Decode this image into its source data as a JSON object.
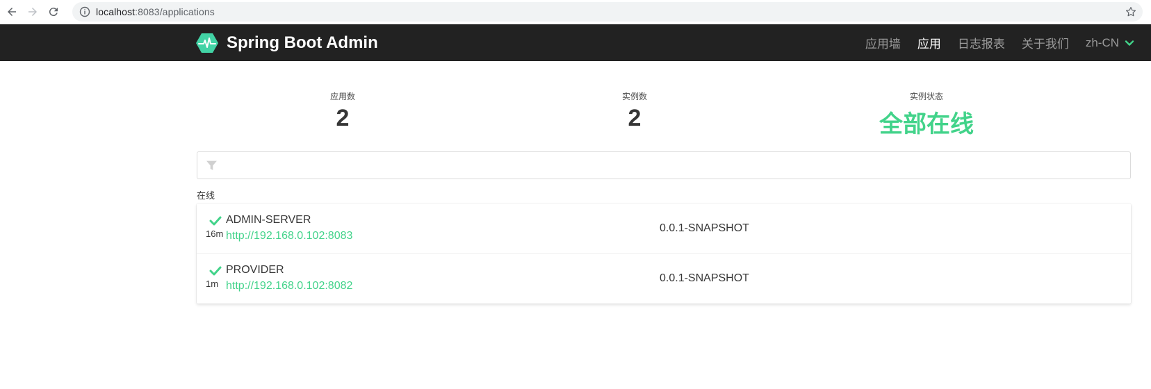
{
  "browser": {
    "url_host": "localhost",
    "url_rest": ":8083/applications"
  },
  "navbar": {
    "brand": "Spring Boot Admin",
    "items": [
      {
        "label": "应用墙",
        "active": false
      },
      {
        "label": "应用",
        "active": true
      },
      {
        "label": "日志报表",
        "active": false
      },
      {
        "label": "关于我们",
        "active": false
      }
    ],
    "language": "zh-CN"
  },
  "stats": {
    "apps_label": "应用数",
    "apps_value": "2",
    "instances_label": "实例数",
    "instances_value": "2",
    "status_label": "实例状态",
    "status_value": "全部在线"
  },
  "filter": {
    "placeholder": "",
    "value": ""
  },
  "group": {
    "label": "在线"
  },
  "applications": [
    {
      "name": "ADMIN-SERVER",
      "uptime": "16m",
      "url": "http://192.168.0.102:8083",
      "version": "0.0.1-SNAPSHOT"
    },
    {
      "name": "PROVIDER",
      "uptime": "1m",
      "url": "http://192.168.0.102:8082",
      "version": "0.0.1-SNAPSHOT"
    }
  ],
  "colors": {
    "navbar_bg": "#222222",
    "accent_green": "#42d38a",
    "brand_logo": "#42d3a5"
  }
}
